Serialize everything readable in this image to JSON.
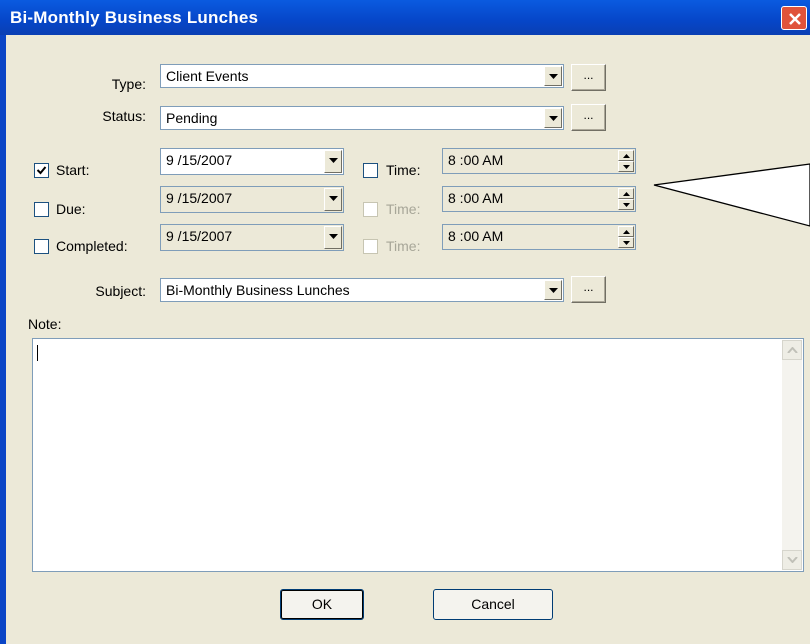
{
  "window": {
    "title": "Bi-Monthly Business Lunches"
  },
  "type": {
    "label": "Type:",
    "value": "Client Events"
  },
  "status": {
    "label": "Status:",
    "value": "Pending"
  },
  "ellipsis": "...",
  "start": {
    "label": "Start:",
    "checked": true,
    "date": "9 /15/2007",
    "time_label": "Time:",
    "time_checked": false,
    "time": "8 :00 AM"
  },
  "due": {
    "label": "Due:",
    "checked": false,
    "date": "9 /15/2007",
    "time_label": "Time:",
    "time_checked": false,
    "time": "8 :00 AM"
  },
  "completed": {
    "label": "Completed:",
    "checked": false,
    "date": "9 /15/2007",
    "time_label": "Time:",
    "time_checked": false,
    "time": "8 :00 AM"
  },
  "subject": {
    "label": "Subject:",
    "value": "Bi-Monthly Business Lunches"
  },
  "note": {
    "label": "Note:",
    "value": ""
  },
  "buttons": {
    "ok": "OK",
    "cancel": "Cancel"
  }
}
